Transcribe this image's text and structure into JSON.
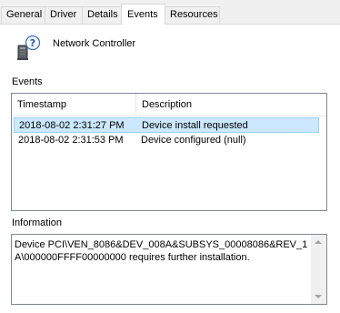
{
  "tabs": [
    {
      "label": "General",
      "active": false
    },
    {
      "label": "Driver",
      "active": false
    },
    {
      "label": "Details",
      "active": false
    },
    {
      "label": "Events",
      "active": true
    },
    {
      "label": "Resources",
      "active": false
    }
  ],
  "device": {
    "name": "Network Controller",
    "icon": "unknown-device-icon"
  },
  "events": {
    "label": "Events",
    "columns": [
      "Timestamp",
      "Description"
    ],
    "rows": [
      {
        "timestamp": "2018-08-02 2:31:27 PM",
        "description": "Device install requested",
        "selected": true
      },
      {
        "timestamp": "2018-08-02 2:31:53 PM",
        "description": "Device configured (null)",
        "selected": false
      }
    ]
  },
  "information": {
    "label": "Information",
    "text": "Device PCI\\VEN_8086&DEV_008A&SUBSYS_00008086&REV_1A\\000000FFFF00000000 requires further installation."
  },
  "colors": {
    "selection": "#cce8ff",
    "selection_border": "#99d1ff",
    "border": "#828790"
  }
}
